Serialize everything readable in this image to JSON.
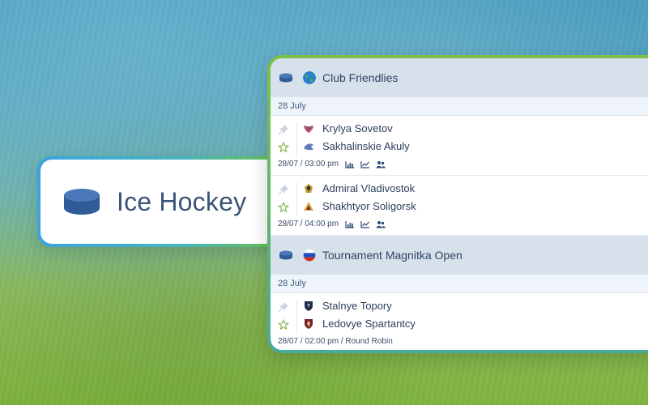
{
  "sport": {
    "title": "Ice Hockey",
    "icon": "puck-icon"
  },
  "colors": {
    "accent_blue": "#3a66a8",
    "text_dark": "#2b3e5a",
    "header_bg": "#d6e1eb"
  },
  "leagues": [
    {
      "name": "Club Friendlies",
      "flag": "globe",
      "date": "28 July",
      "matches": [
        {
          "home": "Krylya Sovetov",
          "away": "Sakhalinskie Akuly",
          "time": "28/07 / 03:00 pm",
          "extras": [
            "stats-icon",
            "trend-icon",
            "lineup-icon"
          ]
        },
        {
          "home": "Admiral Vladivostok",
          "away": "Shakhtyor Soligorsk",
          "time": "28/07 / 04:00 pm",
          "extras": [
            "stats-icon",
            "trend-icon",
            "lineup-icon"
          ]
        }
      ]
    },
    {
      "name": "Tournament Magnitka Open",
      "flag": "russia",
      "date": "28 July",
      "matches": [
        {
          "home": "Stalnye Topory",
          "away": "Ledovye Spartantcy",
          "time": "28/07 / 02:00 pm / Round Robin",
          "extras": []
        }
      ]
    }
  ]
}
